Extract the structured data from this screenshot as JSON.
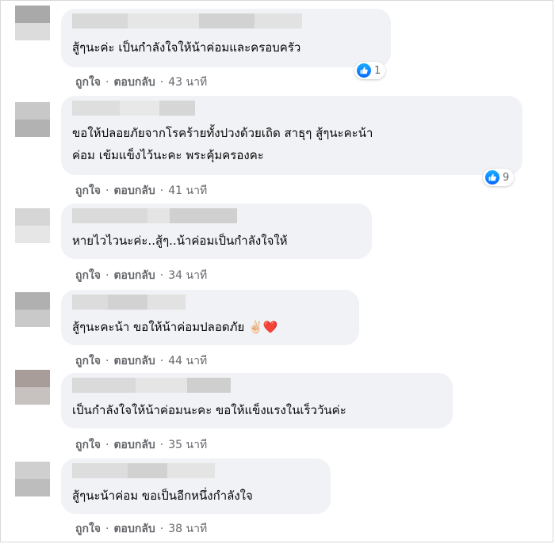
{
  "comments": [
    {
      "text_lines": [
        "สู้ๆนะค่ะ เป็นกำลังใจให้น้าค่อมและครอบครัว"
      ],
      "like_label": "ถูกใจ",
      "reply_label": "ตอบกลับ",
      "time": "43 นาที",
      "reaction_count": "1",
      "reaction_icon": "like-icon"
    },
    {
      "text_lines": [
        "ขอให้ปลอยภัยจากโรคร้ายทั้งปวงด้วยเถิด สาธุๆ สู้ๆนะคะน้า",
        "ค่อม เข้มแข็งไว้นะคะ พระคุ้มครองคะ"
      ],
      "like_label": "ถูกใจ",
      "reply_label": "ตอบกลับ",
      "time": "41 นาที",
      "reaction_count": "9",
      "reaction_icon": "like-icon"
    },
    {
      "text_lines": [
        "หายไวไวนะค่ะ..สู้ๆ..น้าค่อมเป็นกำลังใจให้"
      ],
      "like_label": "ถูกใจ",
      "reply_label": "ตอบกลับ",
      "time": "34 นาที"
    },
    {
      "text_lines": [
        "สู้ๆนะคะน้า ขอให้น้าค่อมปลอดภัย ✌🏻❤️"
      ],
      "like_label": "ถูกใจ",
      "reply_label": "ตอบกลับ",
      "time": "44 นาที"
    },
    {
      "text_lines": [
        "เป็นกำลังใจให้น้าค่อมนะคะ ขอให้แข็งแรงในเร็ววันค่ะ"
      ],
      "like_label": "ถูกใจ",
      "reply_label": "ตอบกลับ",
      "time": "35 นาที"
    },
    {
      "text_lines": [
        "สู้ๆนะน้าค่อม ขอเป็นอีกหนึ่งกำลังใจ"
      ],
      "like_label": "ถูกใจ",
      "reply_label": "ตอบกลับ",
      "time": "38 นาที"
    }
  ],
  "separator": "·",
  "colors": {
    "bubble": "#f0f2f5",
    "text": "#050505",
    "meta": "#65676b",
    "like_blue": "#0766ff"
  }
}
